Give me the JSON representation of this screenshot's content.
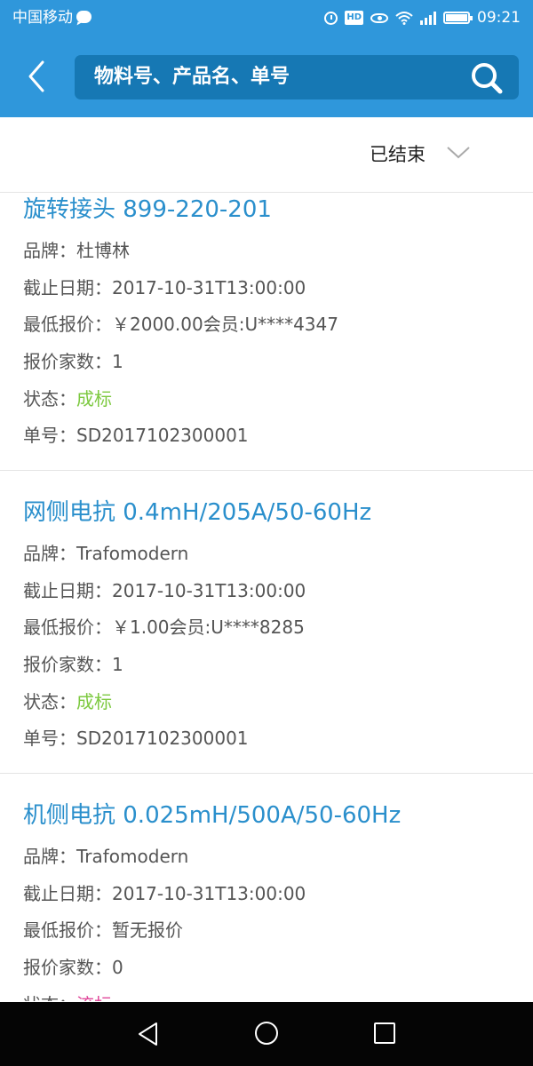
{
  "status_bar": {
    "carrier": "中国移动",
    "hd_label": "HD",
    "time": "09:21"
  },
  "header": {
    "search_placeholder": "物料号、产品名、单号"
  },
  "filter": {
    "selected": "已结束"
  },
  "items": [
    {
      "title": "旋转接头 899-220-201",
      "brand": "品牌：杜博林",
      "deadline": "截止日期：2017-10-31T13:00:00",
      "lowest_price": "最低报价：￥2000.00会员:U****4347",
      "bidder_count": "报价家数：1",
      "status_label": "状态：",
      "status_value": "成标",
      "order_no": "单号：SD2017102300001"
    },
    {
      "title": "网侧电抗  0.4mH/205A/50-60Hz",
      "brand": "品牌：Trafomodern",
      "deadline": "截止日期：2017-10-31T13:00:00",
      "lowest_price": "最低报价：￥1.00会员:U****8285",
      "bidder_count": "报价家数：1",
      "status_label": "状态：",
      "status_value": "成标",
      "order_no": "单号：SD2017102300001"
    },
    {
      "title": "机侧电抗  0.025mH/500A/50-60Hz",
      "brand": "品牌：Trafomodern",
      "deadline": "截止日期：2017-10-31T13:00:00",
      "lowest_price": "最低报价：暂无报价",
      "bidder_count": "报价家数：0",
      "status_label": "状态：",
      "status_value": "流标"
    }
  ],
  "colors": {
    "accent": "#2f97db",
    "title_blue": "#2a8fcc",
    "status_success": "#7dc940",
    "status_failed": "#e0489a"
  }
}
